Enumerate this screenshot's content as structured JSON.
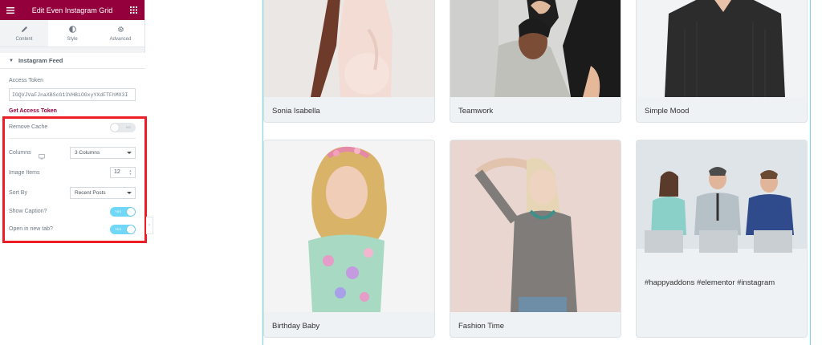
{
  "panel": {
    "title": "Edit Even Instagram Grid",
    "header_color": "#93003c",
    "tabs": [
      {
        "label": "Content",
        "icon": "pencil-icon"
      },
      {
        "label": "Style",
        "icon": "half-circle-icon"
      },
      {
        "label": "Advanced",
        "icon": "gear-icon"
      }
    ],
    "section": "Instagram Feed",
    "access_token_label": "Access Token",
    "access_token_value": "IGQVJVaFJnaXBScG13VHBiOGxyYXdFTFhMX3I",
    "get_token_link": "Get Access Token",
    "remove_cache": {
      "label": "Remove Cache",
      "state": "NO"
    },
    "columns": {
      "label": "Columns",
      "value": "3 Columns"
    },
    "image_items": {
      "label": "Image Items",
      "value": "12"
    },
    "sort_by": {
      "label": "Sort By",
      "value": "Recent Posts"
    },
    "show_caption": {
      "label": "Show Caption?",
      "state": "YES"
    },
    "new_tab": {
      "label": "Open in new tab?",
      "state": "YES"
    },
    "highlight_color": "#ee1c25",
    "toggle_on_color": "#71d7f7"
  },
  "grid": {
    "cards": [
      {
        "caption": "Sonia Isabella"
      },
      {
        "caption": "Teamwork"
      },
      {
        "caption": "Simple Mood"
      },
      {
        "caption": "Birthday Baby"
      },
      {
        "caption": "Fashion Time"
      },
      {
        "caption": "#happyaddons #elementor #instagram"
      }
    ]
  }
}
